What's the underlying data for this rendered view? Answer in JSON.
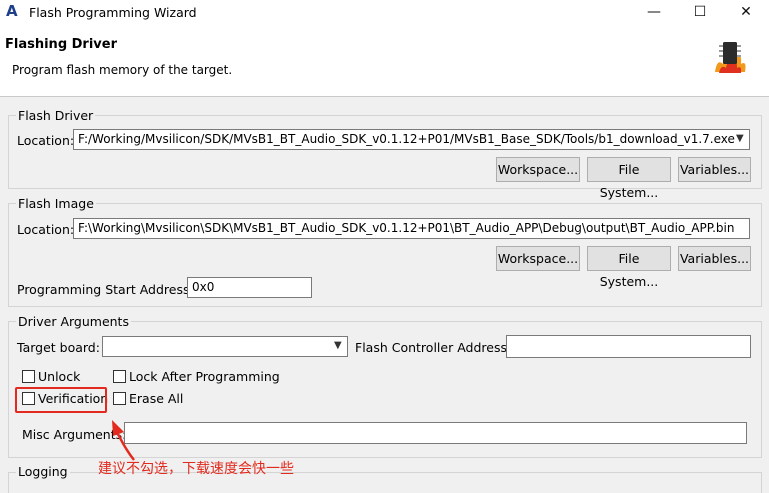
{
  "window": {
    "title": "Flash Programming Wizard",
    "minimize_glyph": "—",
    "maximize_glyph": "☐",
    "close_glyph": "✕"
  },
  "header": {
    "title": "Flashing Driver",
    "subtitle": "Program flash memory of the target.",
    "icon": "flash-chip-icon"
  },
  "flash_driver": {
    "group_label": "Flash Driver",
    "location_label": "Location:",
    "location_value": "F:/Working/Mvsilicon/SDK/MVsB1_BT_Audio_SDK_v0.1.12+P01/MVsB1_Base_SDK/Tools/b1_download_v1.7.exe",
    "buttons": [
      "Workspace...",
      "File System...",
      "Variables..."
    ]
  },
  "flash_image": {
    "group_label": "Flash Image",
    "location_label": "Location:",
    "location_value": "F:\\Working\\Mvsilicon\\SDK\\MVsB1_BT_Audio_SDK_v0.1.12+P01\\BT_Audio_APP\\Debug\\output\\BT_Audio_APP.bin",
    "buttons": [
      "Workspace...",
      "File System...",
      "Variables..."
    ],
    "start_address_label": "Programming Start Address:",
    "start_address_value": "0x0"
  },
  "driver_arguments": {
    "group_label": "Driver Arguments",
    "target_board_label": "Target board:",
    "target_board_value": "",
    "controller_address_label": "Flash Controller Address:",
    "controller_address_value": "",
    "checkboxes": {
      "unlock": {
        "label": "Unlock",
        "checked": false
      },
      "lock_after": {
        "label": "Lock After Programming",
        "checked": false
      },
      "verification": {
        "label": "Verification",
        "checked": false
      },
      "erase_all": {
        "label": "Erase All",
        "checked": false
      }
    },
    "misc_label": "Misc Arguments:",
    "misc_value": ""
  },
  "logging": {
    "group_label": "Logging"
  },
  "annotation": {
    "text": "建议不勾选，下载速度会快一些",
    "color": "#e22b1e"
  }
}
